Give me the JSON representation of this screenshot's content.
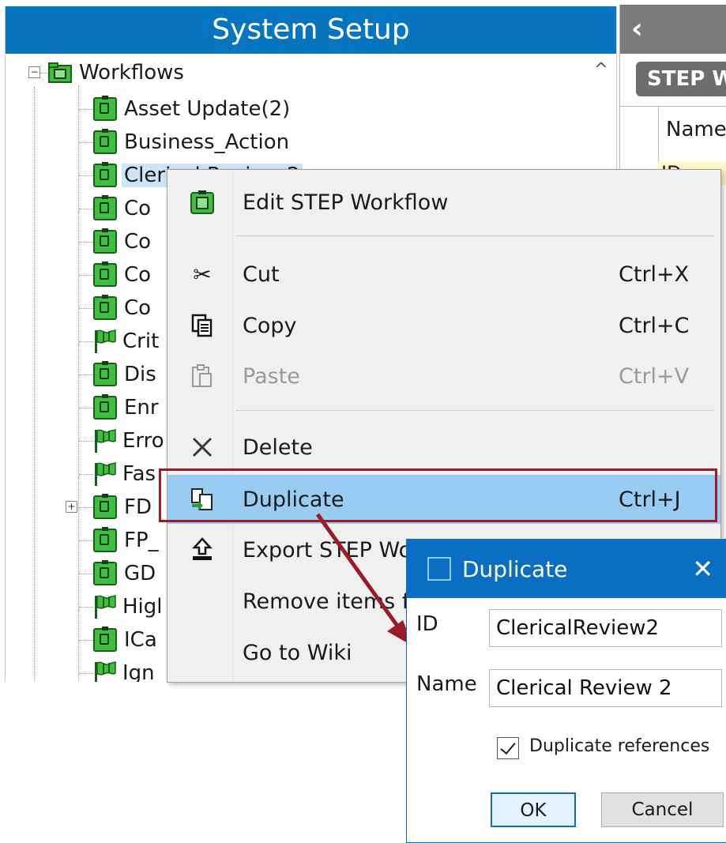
{
  "panel": {
    "title": "System Setup",
    "root_label": "Workflows",
    "items": [
      {
        "label": "Asset Update(2)",
        "icon": "workflow"
      },
      {
        "label": "Business_Action",
        "icon": "workflow"
      },
      {
        "label": "Clerical Review 2",
        "icon": "workflow"
      },
      {
        "label": "Co",
        "icon": "workflow"
      },
      {
        "label": "Co",
        "icon": "workflow"
      },
      {
        "label": "Co",
        "icon": "workflow"
      },
      {
        "label": "Co",
        "icon": "workflow"
      },
      {
        "label": "Crit",
        "icon": "flag"
      },
      {
        "label": "Dis",
        "icon": "workflow"
      },
      {
        "label": "Enr",
        "icon": "workflow"
      },
      {
        "label": "Erro",
        "icon": "flag"
      },
      {
        "label": "Fas",
        "icon": "flag"
      },
      {
        "label": "FD",
        "icon": "workflow"
      },
      {
        "label": "FP_",
        "icon": "workflow"
      },
      {
        "label": "GD",
        "icon": "workflow"
      },
      {
        "label": "Higl",
        "icon": "flag"
      },
      {
        "label": "ICa",
        "icon": "workflow"
      },
      {
        "label": "Ign",
        "icon": "flag"
      }
    ]
  },
  "right_panel": {
    "back_glyph": "‹",
    "button_label": "STEP W",
    "column_name": "Name",
    "row_id": "ID"
  },
  "context_menu": {
    "items": [
      {
        "label": "Edit STEP Workflow",
        "shortcut": "",
        "icon": "workflow-icon"
      },
      {
        "label": "Cut",
        "shortcut": "Ctrl+X",
        "icon": "scissors-icon"
      },
      {
        "label": "Copy",
        "shortcut": "Ctrl+C",
        "icon": "copy-icon"
      },
      {
        "label": "Paste",
        "shortcut": "Ctrl+V",
        "icon": "paste-icon"
      },
      {
        "label": "Delete",
        "shortcut": "",
        "icon": "delete-icon"
      },
      {
        "label": "Duplicate",
        "shortcut": "Ctrl+J",
        "icon": "duplicate-icon"
      },
      {
        "label": "Export STEP Wo",
        "shortcut": "",
        "icon": "export-icon"
      },
      {
        "label": "Remove items f",
        "shortcut": "",
        "icon": ""
      },
      {
        "label": "Go to Wiki",
        "shortcut": "",
        "icon": ""
      }
    ]
  },
  "dialog": {
    "title": "Duplicate",
    "id_label": "ID",
    "id_value": "ClericalReview2",
    "name_label": "Name",
    "name_value": "Clerical Review 2",
    "checkbox_label": "Duplicate references",
    "checkbox_checked": true,
    "ok_label": "OK",
    "cancel_label": "Cancel"
  },
  "colors": {
    "title_bar": "#0774c0",
    "highlight": "#99ccf3",
    "callout": "#9b1c27"
  }
}
